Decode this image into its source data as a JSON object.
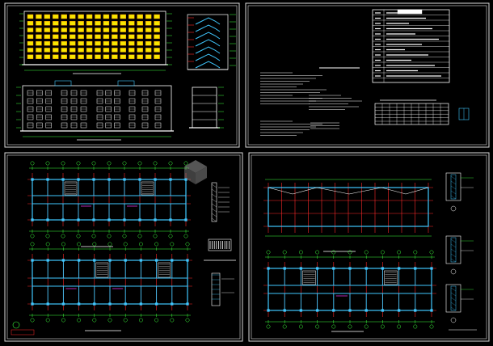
{
  "viewer": {
    "background": "#000000",
    "panel_border_color": "#dcdcdc",
    "grid_color": "#ff2a2a",
    "dimension_color": "#3cff3c",
    "wall_color": "#40c8ff",
    "text_color": "#ffffff",
    "window_color": "#f6e600",
    "sheets": [
      {
        "name": "elevations-sheet",
        "contents": [
          "front-elevation",
          "stair-section",
          "rear-elevation",
          "side-elevation"
        ]
      },
      {
        "name": "design-notes-sheet",
        "contents": [
          "notes-text",
          "index-table",
          "door-window-schedule"
        ]
      },
      {
        "name": "floor-plans-sheet",
        "contents": [
          "upper-floor-plan",
          "lower-floor-plan",
          "wall-details"
        ]
      },
      {
        "name": "roof-plans-sheet",
        "contents": [
          "roof-plan",
          "first-floor-plan",
          "eave-details"
        ]
      }
    ]
  },
  "watermark": {
    "icon": "cube-logo-icon"
  }
}
